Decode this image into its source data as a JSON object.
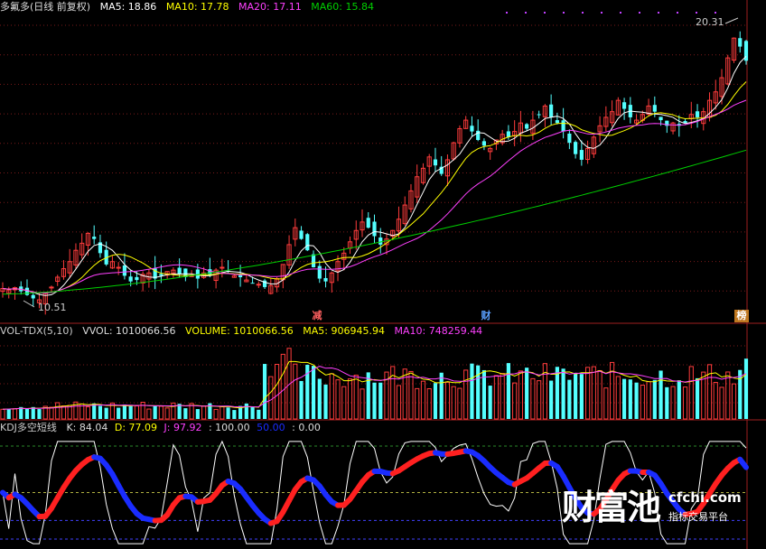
{
  "price_panel": {
    "title": "多氟多(日线 前复权)",
    "ma5": "MA5: 18.86",
    "ma10": "MA10: 17.78",
    "ma20": "MA20: 17.11",
    "ma60": "MA60: 15.84",
    "high_label": "20.31",
    "low_label": "10.51",
    "events": [
      {
        "label": "减",
        "color": "#ff6060"
      },
      {
        "label": "财",
        "color": "#5aa0ff"
      },
      {
        "label": "榜",
        "color": "#ffffff",
        "bg": "#c07820"
      }
    ]
  },
  "volume_panel": {
    "title": "VOL-TDX(5,10)",
    "vvol": "VVOL: 1010066.56",
    "volume": "VOLUME: 1010066.56",
    "ma5": "MA5: 906945.94",
    "ma10": "MA10: 748259.44"
  },
  "kdj_panel": {
    "title": "KDJ多空短线",
    "k": "K: 84.04",
    "d": "D: 77.09",
    "j": "J: 97.92",
    "l100": ": 100.00",
    "l50": "50.00",
    "l0": ": 0.00"
  },
  "watermark": {
    "brand": "财富池",
    "site": "cfchi.com",
    "tagline": "指标交易平台"
  },
  "colors": {
    "up": "#ff3c3c",
    "down": "#54ffff",
    "ma5": "#ffffff",
    "ma10": "#ffff00",
    "ma20": "#ff40ff",
    "ma60": "#00d000",
    "kdj_up": "#ff2020",
    "kdj_down": "#1a2cff"
  },
  "chart_data": [
    {
      "type": "candlestick",
      "title": "多氟多(日线 前复权)",
      "y_high_marked": 20.31,
      "y_low_marked": 10.51,
      "ylim": [
        10.2,
        20.7
      ],
      "series": [
        {
          "name": "MA5",
          "value": 18.86
        },
        {
          "name": "MA10",
          "value": 17.78
        },
        {
          "name": "MA20",
          "value": 17.11
        },
        {
          "name": "MA60",
          "value": 15.84
        }
      ],
      "close": [
        10.95,
        10.9,
        10.98,
        10.85,
        10.72,
        10.6,
        10.55,
        10.78,
        11.0,
        11.35,
        11.65,
        11.9,
        12.3,
        12.55,
        12.9,
        12.7,
        12.2,
        11.8,
        11.9,
        11.7,
        11.4,
        11.2,
        11.25,
        11.45,
        11.5,
        11.3,
        11.4,
        11.55,
        11.6,
        11.45,
        11.35,
        11.4,
        11.3,
        11.5,
        11.45,
        11.6,
        11.7,
        11.55,
        11.4,
        11.35,
        11.25,
        11.15,
        11.1,
        11.0,
        11.05,
        11.3,
        11.8,
        12.5,
        13.1,
        12.7,
        12.3,
        11.7,
        11.3,
        11.2,
        11.5,
        11.9,
        12.2,
        12.6,
        13.0,
        13.3,
        13.1,
        12.8,
        12.5,
        12.7,
        13.0,
        13.4,
        13.9,
        14.4,
        14.9,
        15.2,
        15.6,
        15.3,
        15.0,
        15.5,
        16.1,
        16.6,
        16.9,
        16.5,
        16.2,
        16.0,
        15.9,
        16.2,
        16.4,
        16.3,
        16.5,
        16.8,
        16.6,
        16.9,
        17.1,
        17.4,
        17.0,
        16.8,
        16.5,
        16.1,
        15.7,
        15.5,
        15.9,
        16.3,
        16.7,
        17.0,
        17.2,
        17.6,
        17.3,
        17.0,
        16.9,
        17.1,
        17.4,
        17.2,
        16.9,
        16.7,
        16.8,
        16.7,
        16.8,
        17.1,
        17.0,
        17.2,
        17.6,
        17.9,
        18.4,
        19.1,
        19.8,
        19.5,
        19.0
      ],
      "volume_series": [
        {
          "name": "VVOL",
          "value": 1010066.56
        },
        {
          "name": "MA5",
          "value": 906945.94
        },
        {
          "name": "MA10",
          "value": 748259.44
        }
      ],
      "kdj_series": [
        {
          "name": "K",
          "value": 84.04
        },
        {
          "name": "D",
          "value": 77.09
        },
        {
          "name": "J",
          "value": 97.92
        }
      ],
      "kdj_levels": [
        100,
        50,
        0
      ]
    }
  ]
}
